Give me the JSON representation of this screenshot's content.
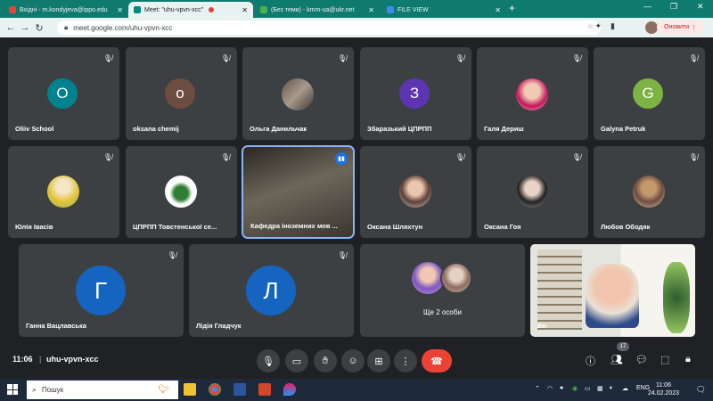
{
  "browser": {
    "tabs": [
      {
        "label": "Вхідні - m.kondyjeva@ippo.edu",
        "active": false,
        "favicon_color": "#ea4335"
      },
      {
        "label": "Meet: \"uhu-vpvn-xcc\"",
        "active": true,
        "favicon_color": "#00897b"
      },
      {
        "label": "(Без теми) - kmm-ua@ukr.net",
        "active": false,
        "favicon_color": "#4caf50"
      },
      {
        "label": "FILE VIEW",
        "active": false,
        "favicon_color": "#4285f4"
      }
    ],
    "url": "meet.google.com/uhu-vpvn-xcc",
    "update_label": "Оновити"
  },
  "tiles": [
    {
      "name": "Oliiv School",
      "initial": "O",
      "color": "#00838f",
      "kind": "initial"
    },
    {
      "name": "oksana chemij",
      "initial": "o",
      "color": "#6d4c41",
      "kind": "initial"
    },
    {
      "name": "Ольга Данильчак",
      "kind": "photo",
      "color": "#7a6f66"
    },
    {
      "name": "Збаразький ЦПРПП",
      "initial": "З",
      "color": "#5e35b1",
      "kind": "initial"
    },
    {
      "name": "Галя Дериш",
      "kind": "photo",
      "color": "#e5a0b8"
    },
    {
      "name": "Galyna Petruk",
      "initial": "G",
      "color": "#7cb342",
      "kind": "initial"
    },
    {
      "name": "Юлія Івасів",
      "kind": "photo",
      "color": "#d9c34a"
    },
    {
      "name": "ЦПРПП Товстенської се...",
      "kind": "photo",
      "color": "#4caf7d"
    },
    {
      "name": "Кафедра іноземних мов ...",
      "kind": "video",
      "color": "#4a463c"
    },
    {
      "name": "Оксана Шляхтун",
      "kind": "photo",
      "color": "#b08a6a"
    },
    {
      "name": "Оксана Гоя",
      "kind": "photo",
      "color": "#6b5a55"
    },
    {
      "name": "Любов Ободяк",
      "kind": "photo",
      "color": "#8a6d4e"
    },
    {
      "name": "Ганна Вацлавська",
      "initial": "Г",
      "color": "#1565c0",
      "kind": "initial"
    },
    {
      "name": "Лідія Гладчук",
      "initial": "Л",
      "color": "#1565c0",
      "kind": "initial"
    },
    {
      "name": "Ще 2 особи",
      "kind": "group",
      "color": "#9c7a8a"
    },
    {
      "name": "Ви",
      "kind": "self",
      "color": "#cfd8dc"
    }
  ],
  "controls": {
    "time": "11:06",
    "meeting_code": "uhu-vpvn-xcc",
    "participants_count": "17"
  },
  "taskbar": {
    "search_placeholder": "Пошук",
    "lang": "ENG",
    "clock_time": "11:06",
    "clock_date": "24.02.2023"
  }
}
